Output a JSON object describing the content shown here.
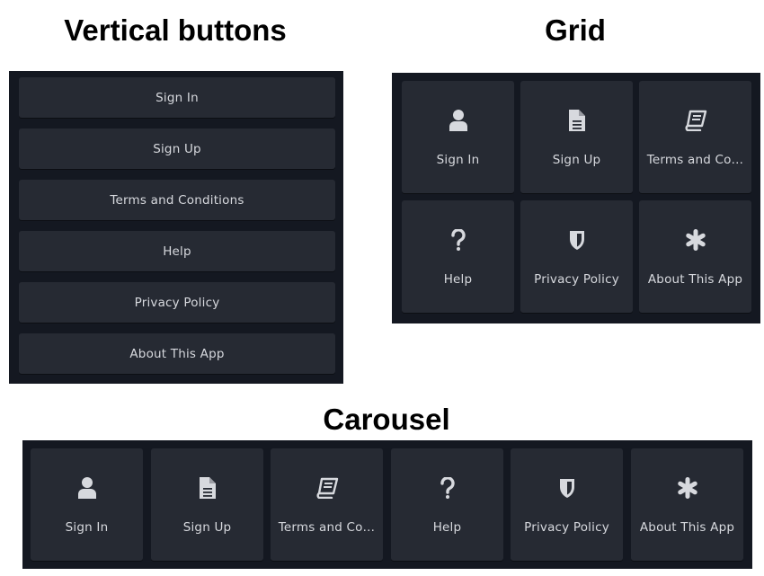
{
  "titles": {
    "vertical": "Vertical buttons",
    "grid": "Grid",
    "carousel": "Carousel"
  },
  "colors": {
    "panel_bg": "#141821",
    "button_bg": "#262a33",
    "text": "#d7d9de",
    "icon": "#d7d9de"
  },
  "vertical_buttons": [
    {
      "label": "Sign In"
    },
    {
      "label": "Sign Up"
    },
    {
      "label": "Terms and Conditions"
    },
    {
      "label": "Help"
    },
    {
      "label": "Privacy Policy"
    },
    {
      "label": "About This App"
    }
  ],
  "grid_tiles": [
    {
      "label": "Sign In",
      "icon": "user-icon"
    },
    {
      "label": "Sign Up",
      "icon": "document-icon"
    },
    {
      "label": "Terms and Co…",
      "icon": "book-icon"
    },
    {
      "label": "Help",
      "icon": "question-icon"
    },
    {
      "label": "Privacy Policy",
      "icon": "shield-icon"
    },
    {
      "label": "About This App",
      "icon": "asterisk-icon"
    }
  ],
  "carousel_tiles": [
    {
      "label": "Sign In",
      "icon": "user-icon"
    },
    {
      "label": "Sign Up",
      "icon": "document-icon"
    },
    {
      "label": "Terms and Co…",
      "icon": "book-icon"
    },
    {
      "label": "Help",
      "icon": "question-icon"
    },
    {
      "label": "Privacy Policy",
      "icon": "shield-icon"
    },
    {
      "label": "About This App",
      "icon": "asterisk-icon"
    }
  ]
}
